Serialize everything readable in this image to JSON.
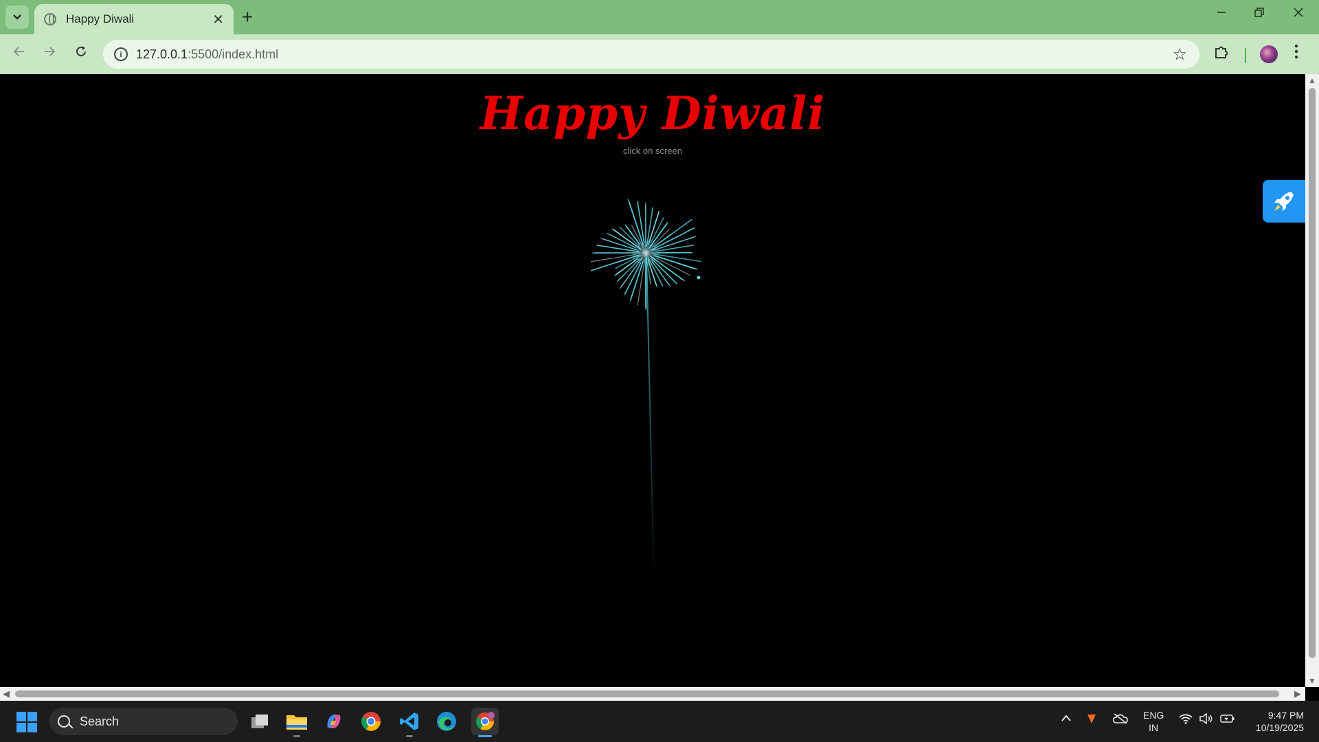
{
  "browser": {
    "tab_title": "Happy Diwali",
    "url_host": "127.0.0.1",
    "url_rest": ":5500/index.html",
    "new_tab": "+",
    "close_tab": "✕"
  },
  "page": {
    "heading": "Happy Diwali",
    "hint": "click on screen",
    "heading_color": "#e80000",
    "firework_color": "#5ad8e6"
  },
  "taskbar": {
    "search_label": "Search",
    "lang_line1": "ENG",
    "lang_line2": "IN",
    "time": "9:47 PM",
    "date": "10/19/2025"
  },
  "icons": {
    "tab_search": "chevron-down-icon",
    "back": "back-arrow-icon",
    "forward": "forward-arrow-icon",
    "reload": "reload-icon",
    "site_info": "info-icon",
    "bookmark": "star-icon",
    "extensions": "puzzle-icon",
    "menu": "kebab-menu-icon",
    "rocket": "rocket-icon"
  }
}
